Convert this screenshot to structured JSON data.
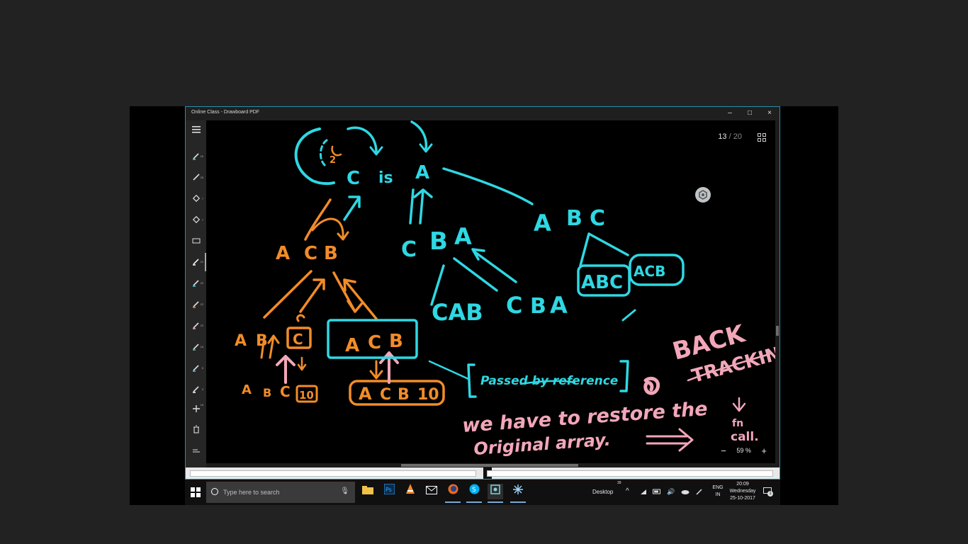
{
  "window": {
    "title": "Online Class - Drawboard PDF",
    "controls": {
      "minimize": "–",
      "maximize": "□",
      "close": "×"
    }
  },
  "sidebar": {
    "menu_icon": "hamburger-menu-icon",
    "badges": [
      "16",
      "28",
      "7",
      "7",
      "22",
      "22",
      "22",
      "22",
      "18",
      "5",
      "3",
      "18"
    ]
  },
  "viewer": {
    "page_current": "13",
    "page_separator": "/",
    "page_total": "20",
    "zoom_minus": "−",
    "zoom_value": "59 %",
    "zoom_plus": "+"
  },
  "board": {
    "cyan_texts": [
      "C",
      "is",
      "A",
      "A",
      "B",
      "C",
      "C",
      "B",
      "A",
      "CAB",
      "C",
      "B",
      "A",
      "ABC",
      "ACB",
      "Passed by reference"
    ],
    "orange_texts": [
      "2",
      "A",
      "C",
      "B",
      "A",
      "B",
      "C",
      "A",
      "C",
      "B",
      "A",
      "B",
      "C",
      "10",
      "A",
      "C",
      "B",
      "10"
    ],
    "pink_texts": [
      "BACK",
      "TRACKIN",
      "we have to restore the",
      "Original array.",
      "fn",
      "call."
    ]
  },
  "taskbar": {
    "search_placeholder": "Type here to search",
    "desktop_label": "Desktop",
    "desktop_badge": "39",
    "lang_line1": "ENG",
    "lang_line2": "IN",
    "time": "20:09",
    "day": "Wednesday",
    "date": "25-10-2017",
    "notification_count": "1"
  },
  "colors": {
    "cyan": "#2ed8e3",
    "orange": "#f28c28",
    "pink": "#f2a7b9",
    "accent_border": "#2a8fa8"
  }
}
